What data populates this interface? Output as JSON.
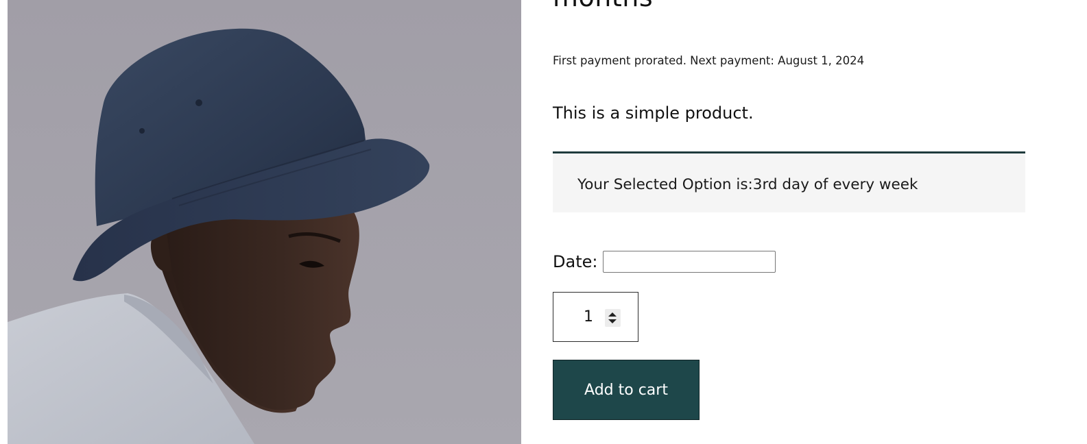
{
  "product": {
    "title_fragment": "months",
    "payment_note": "First payment prorated. Next payment: August 1, 2024",
    "short_description": "This is a simple product.",
    "image": {
      "subject": "model wearing navy bucket hat",
      "icon": "product-photo",
      "colors": {
        "background": "#a3a0a9",
        "hat": "#2e3b52",
        "shirt": "#c3c6cf",
        "skin": "#3b2a24"
      }
    }
  },
  "subscription_option": {
    "text": "Your Selected Option is:3rd day of every week"
  },
  "date_field": {
    "label": "Date:",
    "value": ""
  },
  "quantity": {
    "value": "1"
  },
  "cart": {
    "button_label": "Add to cart"
  },
  "colors": {
    "accent": "#1e474a",
    "option_border": "#1f3b3d",
    "option_background": "#f5f5f5"
  }
}
